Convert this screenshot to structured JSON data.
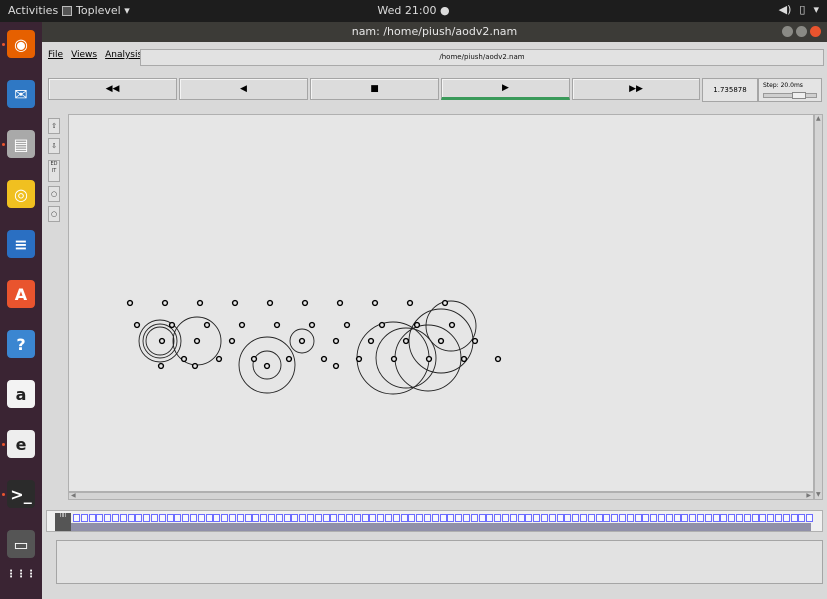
{
  "topbar": {
    "activities": "Activities",
    "app_name": "Toplevel ▾",
    "clock": "Wed 21:00 ●",
    "tray_sound": "◀)",
    "tray_battery": "▯",
    "tray_menu": "▾"
  },
  "window": {
    "title": "nam: /home/piush/aodv2.nam"
  },
  "menu": {
    "file": "File",
    "views": "Views",
    "analysis": "Analysis",
    "filename": "/home/piush/aodv2.nam"
  },
  "controls": {
    "rewind": "◀◀",
    "back": "◀",
    "stop": "■",
    "play": "▶",
    "fast_forward": "▶▶",
    "time": "1.735878",
    "step_label": "Step: 20.0ms",
    "step_fraction": 0.7
  },
  "tools": {
    "zoom_in": "⇧",
    "zoom_out": "⇩",
    "edit": "ED IT"
  },
  "timeline": {
    "marker": "IIII",
    "cell_count": 95
  },
  "colors": {
    "accent_play": "#3a9a5a",
    "dock_bg": "#3a2433",
    "close_button": "#e9542e"
  },
  "dock": [
    {
      "icon": "firefox-icon",
      "glyph": "◉",
      "color": "#e66000"
    },
    {
      "icon": "thunderbird-icon",
      "glyph": "✉",
      "color": "#2f78c4"
    },
    {
      "icon": "files-icon",
      "glyph": "▤",
      "color": "#a9a9a9"
    },
    {
      "icon": "rhythmbox-icon",
      "glyph": "◎",
      "color": "#f0c020"
    },
    {
      "icon": "writer-icon",
      "glyph": "≡",
      "color": "#2a6fc2"
    },
    {
      "icon": "software-icon",
      "glyph": "A",
      "color": "#e9542e"
    },
    {
      "icon": "help-icon",
      "glyph": "?",
      "color": "#3b86d1"
    },
    {
      "icon": "amazon-icon",
      "glyph": "a",
      "color": "#f3f3f3"
    },
    {
      "icon": "settings-icon",
      "glyph": "e",
      "color": "#eeeeee"
    },
    {
      "icon": "terminal-icon",
      "glyph": ">_",
      "color": "#2b2b2b"
    },
    {
      "icon": "trash-icon",
      "glyph": "▭",
      "color": "#555555"
    },
    {
      "icon": "show-apps-icon",
      "glyph": "⋮⋮⋮",
      "color": "#3a2433"
    }
  ]
}
